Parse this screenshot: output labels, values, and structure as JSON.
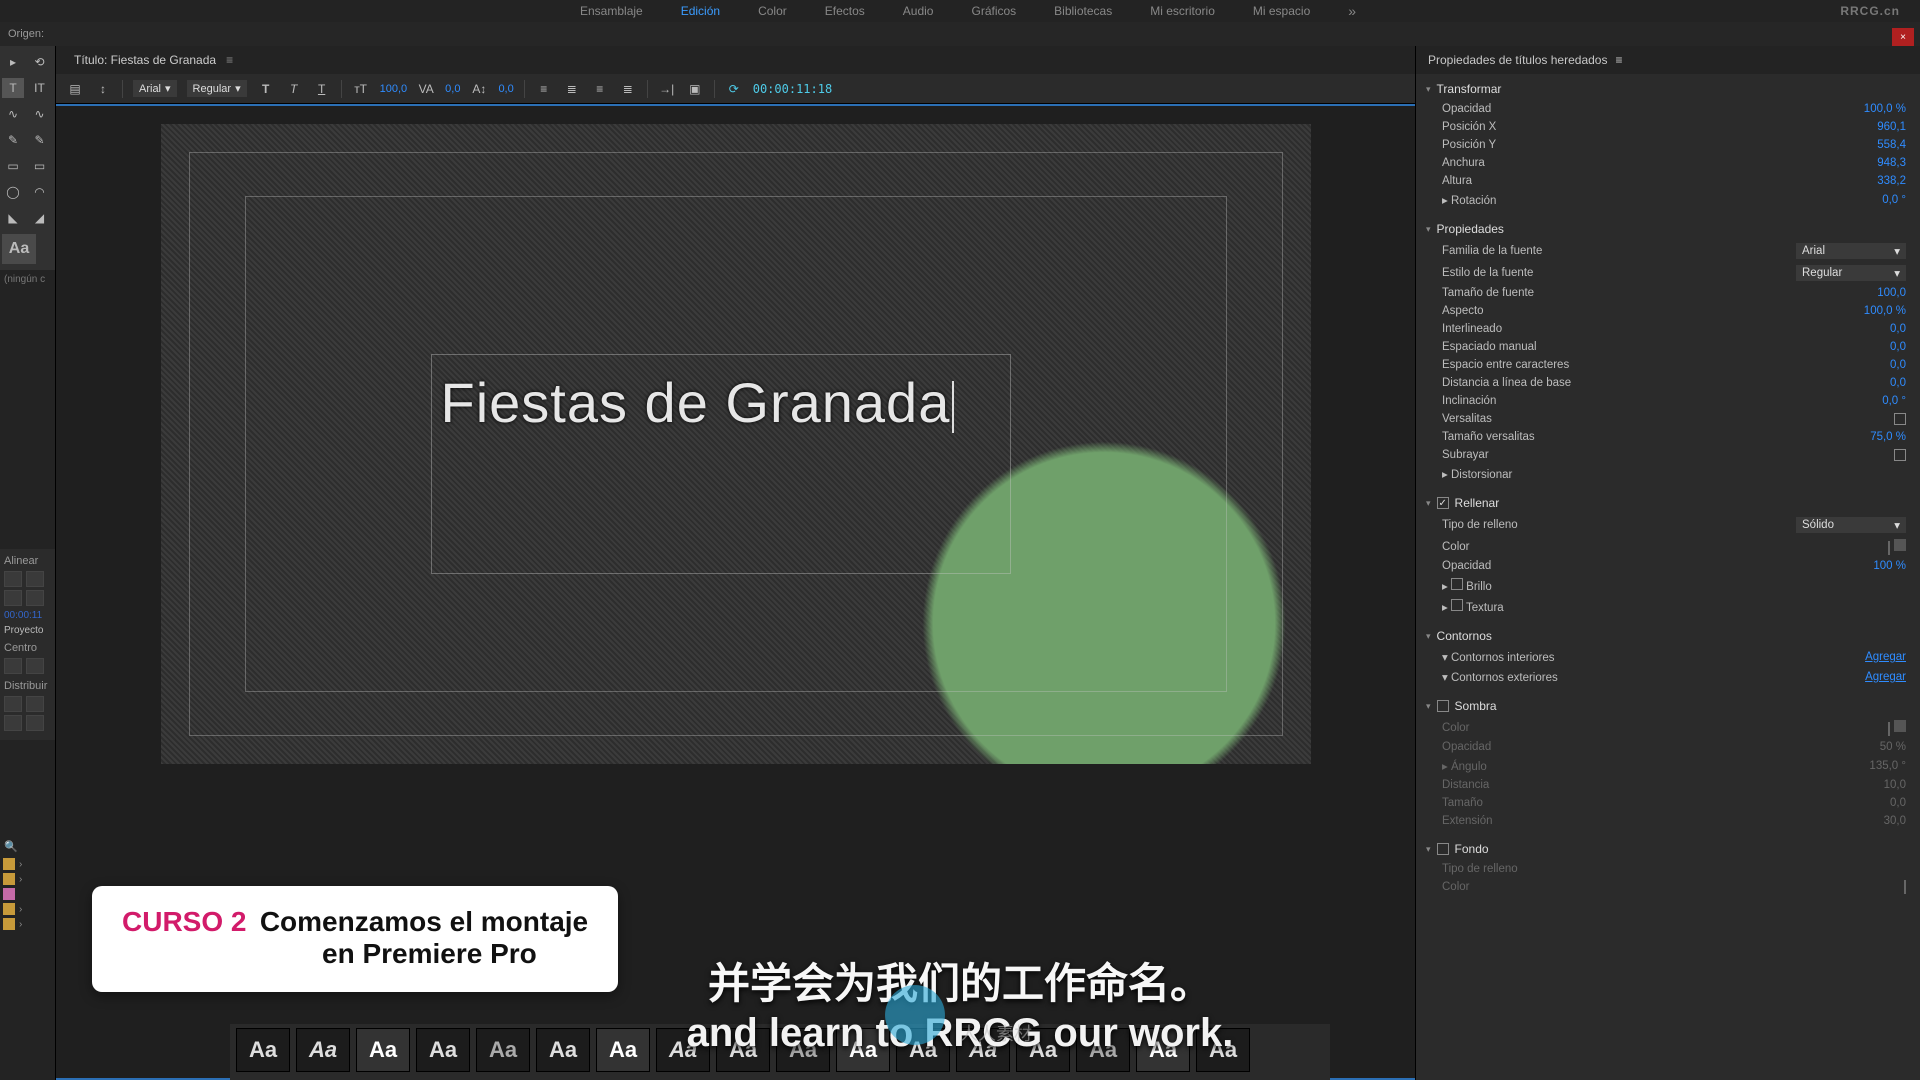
{
  "menu": {
    "items": [
      "Ensamblaje",
      "Edición",
      "Color",
      "Efectos",
      "Audio",
      "Gráficos",
      "Bibliotecas",
      "Mi escritorio",
      "Mi espacio"
    ],
    "active_index": 1,
    "more": "»",
    "brand": "RRCG.cn"
  },
  "origin_label": "Origen:",
  "no_clip": "(ningún c",
  "title_tab": "Título: Fiestas de Granada",
  "toolbar": {
    "font_family": "Arial",
    "font_style": "Regular",
    "font_size": "100,0",
    "tracking": "0,0",
    "leading": "0,0",
    "timecode": "00:00:11:18"
  },
  "canvas": {
    "title_text": "Fiestas de Granada"
  },
  "align": {
    "hdr1": "Alinear",
    "hdr2": "Centro",
    "hdr3": "Distribuir",
    "tc": "00:00:11",
    "proj": "Proyecto"
  },
  "styles_sample": "Aa",
  "right_panel": {
    "title": "Propiedades de títulos heredados",
    "transformar": {
      "header": "Transformar",
      "opacidad": {
        "lbl": "Opacidad",
        "val": "100,0 %"
      },
      "posx": {
        "lbl": "Posición X",
        "val": "960,1"
      },
      "posy": {
        "lbl": "Posición Y",
        "val": "558,4"
      },
      "anchura": {
        "lbl": "Anchura",
        "val": "948,3"
      },
      "altura": {
        "lbl": "Altura",
        "val": "338,2"
      },
      "rotacion": {
        "lbl": "Rotación",
        "val": "0,0 °"
      }
    },
    "propiedades": {
      "header": "Propiedades",
      "familia": {
        "lbl": "Familia de la fuente",
        "val": "Arial"
      },
      "estilo": {
        "lbl": "Estilo de la fuente",
        "val": "Regular"
      },
      "tam": {
        "lbl": "Tamaño de fuente",
        "val": "100,0"
      },
      "aspecto": {
        "lbl": "Aspecto",
        "val": "100,0 %"
      },
      "inter": {
        "lbl": "Interlineado",
        "val": "0,0"
      },
      "espman": {
        "lbl": "Espaciado manual",
        "val": "0,0"
      },
      "espcar": {
        "lbl": "Espacio entre caracteres",
        "val": "0,0"
      },
      "distbase": {
        "lbl": "Distancia a línea de base",
        "val": "0,0"
      },
      "incl": {
        "lbl": "Inclinación",
        "val": "0,0 °"
      },
      "vers": {
        "lbl": "Versalitas"
      },
      "tamvers": {
        "lbl": "Tamaño versalitas",
        "val": "75,0 %"
      },
      "subr": {
        "lbl": "Subrayar"
      },
      "dist": {
        "lbl": "Distorsionar"
      }
    },
    "rellenar": {
      "header": "Rellenar",
      "tipo": {
        "lbl": "Tipo de relleno",
        "val": "Sólido"
      },
      "color": {
        "lbl": "Color"
      },
      "opac": {
        "lbl": "Opacidad",
        "val": "100 %"
      },
      "brillo": {
        "lbl": "Brillo"
      },
      "textura": {
        "lbl": "Textura"
      }
    },
    "contornos": {
      "header": "Contornos",
      "inner": {
        "lbl": "Contornos interiores",
        "val": "Agregar"
      },
      "outer": {
        "lbl": "Contornos exteriores",
        "val": "Agregar"
      }
    },
    "sombra": {
      "header": "Sombra",
      "color": {
        "lbl": "Color"
      },
      "opac": {
        "lbl": "Opacidad",
        "val": "50 %"
      },
      "ang": {
        "lbl": "Ángulo",
        "val": "135,0 °"
      },
      "dist": {
        "lbl": "Distancia",
        "val": "10,0"
      },
      "tam": {
        "lbl": "Tamaño",
        "val": "0,0"
      },
      "ext": {
        "lbl": "Extensión",
        "val": "30,0"
      }
    },
    "fondo": {
      "header": "Fondo",
      "tipo": {
        "lbl": "Tipo de relleno"
      },
      "color": {
        "lbl": "Color"
      }
    }
  },
  "overlay": {
    "course_tag": "CURSO 2",
    "course_line1": "Comenzamos el montaje",
    "course_line2": "en Premiere Pro",
    "sub_zh": "并学会为我们的工作命名。",
    "sub_en": "and learn to RRCG our work.",
    "wm_txt": "人人素材"
  }
}
